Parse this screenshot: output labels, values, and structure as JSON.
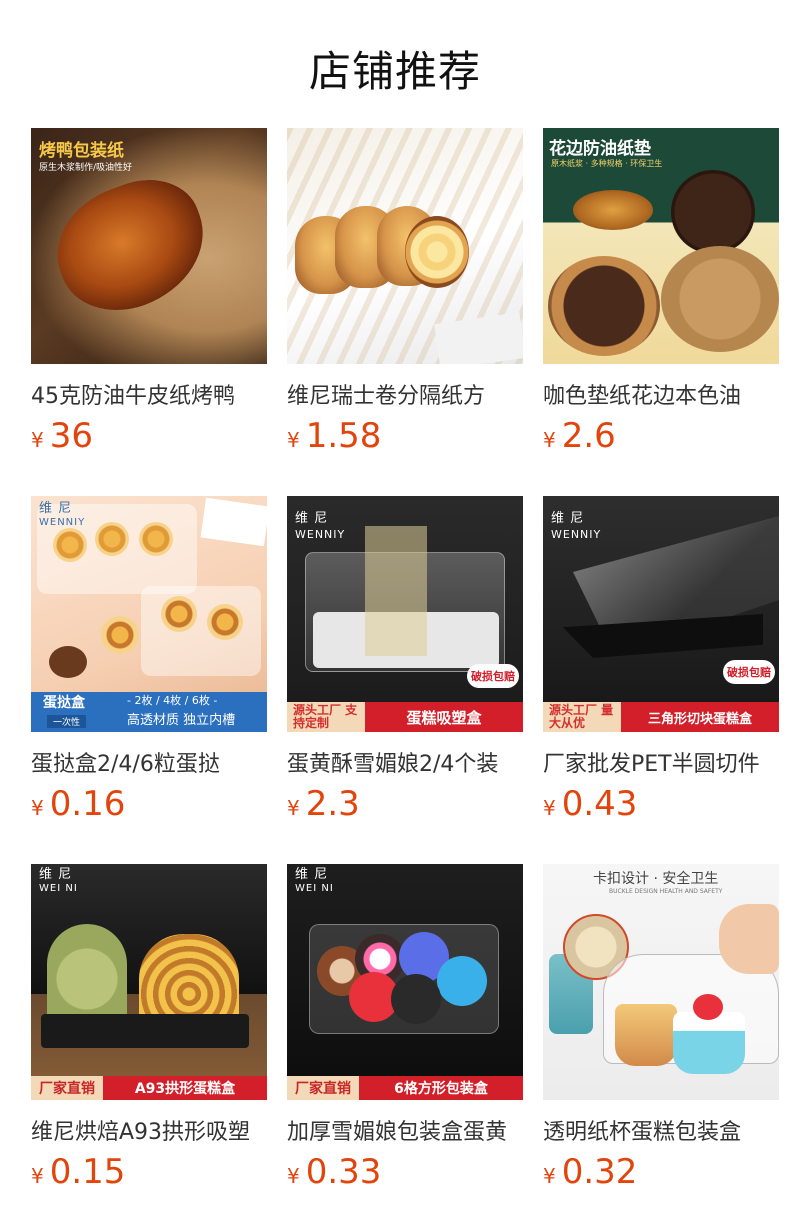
{
  "page_title": "店铺推荐",
  "currency": "¥",
  "products": [
    {
      "name": "45克防油牛皮纸烤鸭",
      "price": "36",
      "img": {
        "title": "烤鸭包装纸",
        "sub": "原生木浆制作/吸油性好"
      }
    },
    {
      "name": "维尼瑞士卷分隔纸方",
      "price": "1.58",
      "img": {}
    },
    {
      "name": "咖色垫纸花边本色油",
      "price": "2.6",
      "img": {
        "title": "花边防油纸垫",
        "sub": "原木纸浆 · 多种规格 · 环保卫生"
      }
    },
    {
      "name": "蛋挞盒2/4/6粒蛋挞",
      "price": "0.16",
      "img": {
        "brand_cn": "维 尼",
        "brand_en": "WENNIY",
        "label": "蛋挞盒",
        "sub_label": "一次性",
        "sizes": "- 2枚 / 4枚 / 6枚 -",
        "features": "高透材质 独立内槽"
      }
    },
    {
      "name": "蛋黄酥雪媚娘2/4个装",
      "price": "2.3",
      "img": {
        "brand_cn": "维 尼",
        "brand_en": "WENNIY",
        "badge": "破损包赔",
        "left": "源头工厂 支持定制",
        "right": "蛋糕吸塑盒"
      }
    },
    {
      "name": "厂家批发PET半圆切件",
      "price": "0.43",
      "img": {
        "brand_cn": "维 尼",
        "brand_en": "WENNIY",
        "badge": "破损包赔",
        "left": "源头工厂 量大从优",
        "right": "三角形切块蛋糕盒"
      }
    },
    {
      "name": "维尼烘焙A93拱形吸塑",
      "price": "0.15",
      "img": {
        "brand_cn": "维 尼",
        "brand_en": "WEI NI",
        "left": "厂家直销",
        "right": "A93拱形蛋糕盒"
      }
    },
    {
      "name": "加厚雪媚娘包装盒蛋黄",
      "price": "0.33",
      "img": {
        "brand_cn": "维 尼",
        "brand_en": "WEI NI",
        "left": "厂家直销",
        "right": "6格方形包装盒"
      }
    },
    {
      "name": "透明纸杯蛋糕包装盒",
      "price": "0.32",
      "img": {
        "title": "卡扣设计 · 安全卫生",
        "sub": "BUCKLE DESIGN HEALTH AND SAFETY"
      }
    }
  ]
}
